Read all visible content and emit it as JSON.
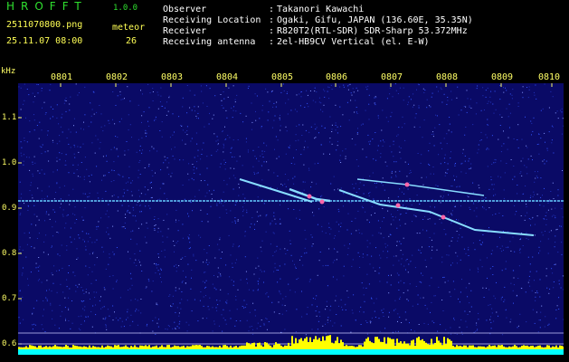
{
  "header": {
    "app_name": "HROFFT",
    "version": "1.0.0",
    "filename": "2511070800.png",
    "datetime": "25.11.07 08:00",
    "meteor_label": "meteor",
    "meteor_count": "26",
    "fields": [
      {
        "label": "Observer",
        "sep": ":",
        "value": "Takanori Kawachi"
      },
      {
        "label": "Receiving Location",
        "sep": ":",
        "value": "Ogaki, Gifu, JAPAN (136.60E, 35.35N)"
      },
      {
        "label": "Receiver",
        "sep": ":",
        "value": "R820T2(RTL-SDR) SDR-Sharp 53.372MHz"
      },
      {
        "label": "Receiving antenna",
        "sep": ":",
        "value": "2el-HB9CV Vertical (el. E-W)"
      }
    ]
  },
  "plot": {
    "y_unit": "kHz",
    "y_ticks": [
      "1.1",
      "1.0",
      "0.9",
      "0.8",
      "0.7",
      "0.6"
    ],
    "x_ticks": [
      "0801",
      "0802",
      "0803",
      "0804",
      "0805",
      "0806",
      "0807",
      "0808",
      "0809",
      "0810"
    ],
    "colors": {
      "background": "#0a0a66",
      "noise": "#3355ff",
      "carrier": "#66ccff",
      "activity": "#ffff00",
      "baseline": "#00ffff"
    }
  }
}
